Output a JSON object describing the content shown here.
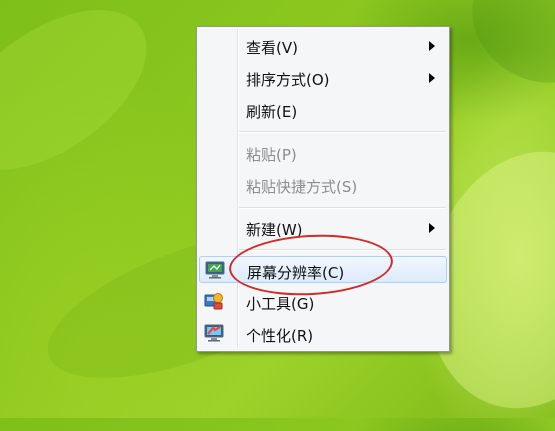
{
  "context_menu": {
    "items": [
      {
        "label": "查看(V)",
        "submenu": true,
        "enabled": true
      },
      {
        "label": "排序方式(O)",
        "submenu": true,
        "enabled": true
      },
      {
        "label": "刷新(E)",
        "submenu": false,
        "enabled": true
      },
      {
        "label": "粘贴(P)",
        "submenu": false,
        "enabled": false
      },
      {
        "label": "粘贴快捷方式(S)",
        "submenu": false,
        "enabled": false
      },
      {
        "label": "新建(W)",
        "submenu": true,
        "enabled": true
      },
      {
        "label": "屏幕分辨率(C)",
        "submenu": false,
        "enabled": true,
        "highlighted": true,
        "icon": "screen-resolution-icon"
      },
      {
        "label": "小工具(G)",
        "submenu": false,
        "enabled": true,
        "icon": "gadgets-icon"
      },
      {
        "label": "个性化(R)",
        "submenu": false,
        "enabled": true,
        "icon": "personalize-icon"
      }
    ]
  },
  "annotation": {
    "color": "#d22a2a"
  },
  "colors": {
    "wallpaper": "#8cc81f",
    "menu_bg": "#f5f6f7",
    "hover_border": "#aecff7"
  }
}
